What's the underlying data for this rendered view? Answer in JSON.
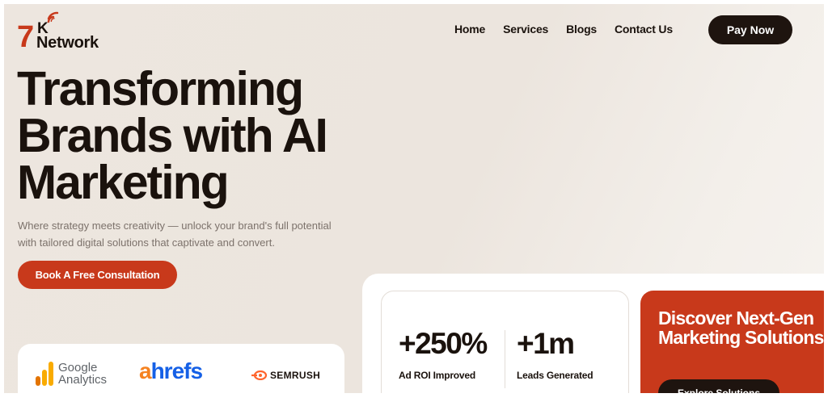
{
  "brand": {
    "logo_number": "7",
    "logo_letter": "K",
    "logo_word": "Network",
    "accent": "#c8391b",
    "dark": "#1e140f"
  },
  "nav": {
    "items": [
      {
        "label": "Home"
      },
      {
        "label": "Services"
      },
      {
        "label": "Blogs"
      },
      {
        "label": "Contact Us"
      }
    ]
  },
  "header": {
    "pay_label": "Pay Now"
  },
  "hero": {
    "title": "Transforming Brands with AI Marketing",
    "subtitle": "Where strategy meets creativity — unlock your brand's full potential with tailored digital solutions that captivate and convert.",
    "cta_label": "Book A Free Consultation"
  },
  "partners": {
    "google_analytics_line1": "Google",
    "google_analytics_line2": "Analytics",
    "ahrefs_first": "a",
    "ahrefs_rest": "hrefs",
    "semrush": "SEMRUSH"
  },
  "stats": [
    {
      "value": "+250%",
      "label": "Ad ROI Improved"
    },
    {
      "value": "+1m",
      "label": "Leads Generated"
    }
  ],
  "discover": {
    "title": "Discover Next-Gen Marketing Solutions",
    "button_label": "Explore Solutions"
  },
  "icons": {
    "logo_signal": "wifi-signal-icon",
    "ga": "google-analytics-icon",
    "semrush": "semrush-flame-icon"
  }
}
